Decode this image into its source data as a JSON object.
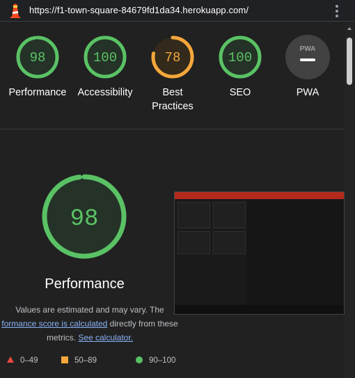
{
  "window": {
    "url": "https://f1-town-square-84679fd1da34.herokuapp.com/"
  },
  "colors": {
    "pass": "#5ac265",
    "average": "#f5a73b",
    "fail": "#e94a3f",
    "pwa": "#4a4a4a",
    "link": "#8ab4f8"
  },
  "scores": [
    {
      "value": "98",
      "label": "Performance",
      "status": "pass",
      "fraction": 0.98
    },
    {
      "value": "100",
      "label": "Accessibility",
      "status": "pass",
      "fraction": 1.0
    },
    {
      "value": "78",
      "label": "Best Practices",
      "status": "average",
      "fraction": 0.78
    },
    {
      "value": "100",
      "label": "SEO",
      "status": "pass",
      "fraction": 1.0
    }
  ],
  "pwa": {
    "label": "PWA",
    "badge": "PWA",
    "icon": "pwa-na-icon"
  },
  "detail": {
    "score": "98",
    "fraction": 0.98,
    "title": "Performance",
    "line1": "Values are estimated and may vary. The",
    "link1": "formance score is calculated",
    "line2_rest": " directly from these",
    "line3": "metrics. ",
    "link2": "See calculator."
  },
  "legend": [
    {
      "label": "0–49",
      "marker": "triangle"
    },
    {
      "label": "50–89",
      "marker": "square"
    },
    {
      "label": "90–100",
      "marker": "circle"
    }
  ]
}
